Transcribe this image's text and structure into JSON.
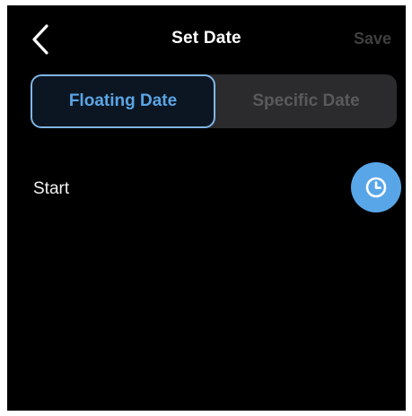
{
  "header": {
    "back_icon": "chevron-left-icon",
    "title": "Set Date",
    "save_label": "Save"
  },
  "tabs": [
    {
      "label": "Floating Date",
      "selected": true
    },
    {
      "label": "Specific Date",
      "selected": false
    }
  ],
  "start": {
    "label": "Start",
    "icon": "clock-icon"
  },
  "colors": {
    "background": "#000000",
    "accent": "#58a6e8",
    "selected_tab_text": "#5aa5e6",
    "selected_tab_border": "#7fb6e6",
    "inactive_tab_bg": "#2b2b2d",
    "inactive_text": "#5a5a5c",
    "save_disabled": "#3f3f3f"
  }
}
